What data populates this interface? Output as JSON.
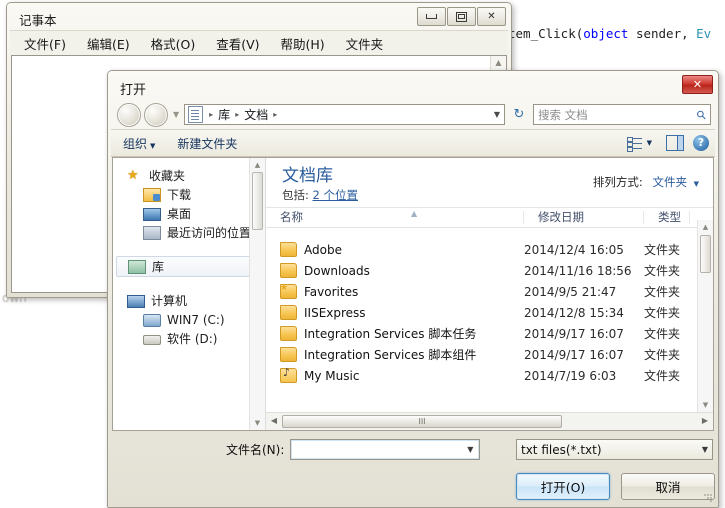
{
  "background": {
    "code_prefix": "tem_Click(",
    "code_kw": "object",
    "code_mid": " sender, ",
    "code_type": "Ev",
    "ghost_text": "own"
  },
  "notepad": {
    "title": "记事本",
    "menu": [
      "文件(F)",
      "编辑(E)",
      "格式(O)",
      "查看(V)",
      "帮助(H)",
      "文件夹"
    ],
    "buttons": {
      "minimize": "minimize",
      "maximize": "maximize",
      "close": "✕"
    }
  },
  "dialog": {
    "title": "打开",
    "close_label": "✕",
    "nav": {
      "back": "back",
      "forward": "forward",
      "history_caret": "▼",
      "breadcrumb": [
        "库",
        "文档"
      ],
      "breadcrumb_sep": "▸",
      "crumb_caret": "▼",
      "refresh": "↻"
    },
    "search": {
      "placeholder": "搜索 文档",
      "icon": "⚲"
    },
    "command_bar": {
      "organize": "组织",
      "organize_caret": "▼",
      "new_folder": "新建文件夹",
      "view_caret": "▼",
      "help": "?"
    },
    "nav_pane": {
      "groups": [
        {
          "label": "收藏夹",
          "icon": "star-icon",
          "level": 1,
          "selected": false
        },
        {
          "label": "下载",
          "icon": "downloads-icon",
          "level": 2,
          "selected": false
        },
        {
          "label": "桌面",
          "icon": "desktop-icon",
          "level": 2,
          "selected": false
        },
        {
          "label": "最近访问的位置",
          "icon": "recent-places-icon",
          "level": 2,
          "selected": false
        },
        {
          "label": "库",
          "icon": "library-icon",
          "level": 1,
          "selected": true
        },
        {
          "label": "计算机",
          "icon": "computer-icon",
          "level": 1,
          "selected": false
        },
        {
          "label": "WIN7 (C:)",
          "icon": "hard-drive-icon",
          "level": 2,
          "selected": false
        },
        {
          "label": "软件 (D:)",
          "icon": "drive-icon",
          "level": 2,
          "selected": false
        }
      ]
    },
    "library": {
      "title": "文档库",
      "subtitle_prefix": "包括:",
      "subtitle_link": "2 个位置",
      "arrange_label": "排列方式:",
      "arrange_value": "文件夹",
      "arrange_caret": "▼"
    },
    "columns": [
      "名称",
      "修改日期",
      "类型"
    ],
    "sort_indicator": "▲",
    "files": [
      {
        "name": "Adobe",
        "modified": "2014/12/4 16:05",
        "type": "文件夹",
        "icon": "folder-icon"
      },
      {
        "name": "Downloads",
        "modified": "2014/11/16 18:56",
        "type": "文件夹",
        "icon": "folder-icon"
      },
      {
        "name": "Favorites",
        "modified": "2014/9/5 21:47",
        "type": "文件夹",
        "icon": "favorites-folder-icon"
      },
      {
        "name": "IISExpress",
        "modified": "2014/12/8 15:34",
        "type": "文件夹",
        "icon": "folder-icon"
      },
      {
        "name": "Integration Services 脚本任务",
        "modified": "2014/9/17 16:07",
        "type": "文件夹",
        "icon": "folder-icon"
      },
      {
        "name": "Integration Services 脚本组件",
        "modified": "2014/9/17 16:07",
        "type": "文件夹",
        "icon": "folder-icon"
      },
      {
        "name": "My Music",
        "modified": "2014/7/19 6:03",
        "type": "文件夹",
        "icon": "music-folder-icon"
      }
    ],
    "scroll": {
      "up_arrow": "▲",
      "down_arrow": "▼",
      "left_arrow": "◀",
      "right_arrow": "▶",
      "grip": "III"
    },
    "footer": {
      "filename_label": "文件名(N):",
      "filename_value": "",
      "filename_caret": "▼",
      "filter_value": "txt files(*.txt)",
      "filter_caret": "▼",
      "open_button": "打开(O)",
      "cancel_button": "取消"
    }
  }
}
